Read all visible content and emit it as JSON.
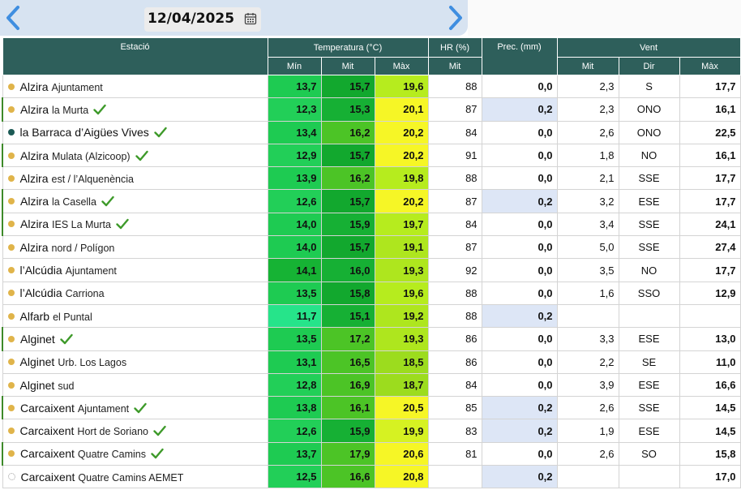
{
  "date": "12/04/2025",
  "icons": {
    "prev": "chevron-left-icon",
    "next": "chevron-right-icon",
    "calendar": "calendar-icon",
    "check": "checkmark-icon"
  },
  "colors": {
    "header": "#2e5f5b",
    "dot_default": "#e0b44a",
    "dot_dark": "#1c5a55",
    "check": "#3e9a2a",
    "prec_highlight": "#dde6f6"
  },
  "headers": {
    "station": "Estació",
    "temperature": "Temperatura (°C)",
    "humidity": "HR (%)",
    "precipitation": "Prec. (mm)",
    "wind": "Vent",
    "temp_min": "Mín",
    "temp_avg": "Mit",
    "temp_max": "Màx",
    "hr_avg": "Mit",
    "wind_avg": "Mit",
    "wind_dir": "Dir",
    "wind_max": "Màx"
  },
  "rows": [
    {
      "name": "Alzira",
      "sub": "Ajuntament",
      "check": false,
      "dot": "gold",
      "mark": false,
      "tmin": "13,7",
      "tavg": "15,7",
      "tmax": "19,6",
      "cmin": "#1ecb52",
      "cavg": "#12a82e",
      "cmax": "#b6ec1e",
      "hr": "88",
      "prec": "0,0",
      "pp": false,
      "wavg": "2,3",
      "wdir": "S",
      "wmax": "17,7"
    },
    {
      "name": "Alzira",
      "sub": "la Murta",
      "check": true,
      "dot": "gold",
      "mark": true,
      "tmin": "12,3",
      "tavg": "15,3",
      "tmax": "20,1",
      "cmin": "#22cf58",
      "cavg": "#16b034",
      "cmax": "#f6f626",
      "hr": "87",
      "prec": "0,2",
      "pp": true,
      "wavg": "2,3",
      "wdir": "ONO",
      "wmax": "16,1"
    },
    {
      "name": "la Barraca d’Aigües Vives",
      "sub": "",
      "check": true,
      "dot": "dark",
      "mark": false,
      "tmin": "13,4",
      "tavg": "16,2",
      "tmax": "20,2",
      "cmin": "#1ecb52",
      "cavg": "#4cc426",
      "cmax": "#f6f626",
      "hr": "84",
      "prec": "0,0",
      "pp": false,
      "wavg": "2,6",
      "wdir": "ONO",
      "wmax": "22,5"
    },
    {
      "name": "Alzira",
      "sub": "Mulata (Alzicoop)",
      "check": true,
      "dot": "gold",
      "mark": true,
      "tmin": "12,9",
      "tavg": "15,7",
      "tmax": "20,2",
      "cmin": "#22cf58",
      "cavg": "#12a82e",
      "cmax": "#f6f626",
      "hr": "91",
      "prec": "0,0",
      "pp": false,
      "wavg": "1,8",
      "wdir": "NO",
      "wmax": "16,1"
    },
    {
      "name": "Alzira",
      "sub": "est / l’Alquenència",
      "check": false,
      "dot": "gold",
      "mark": false,
      "tmin": "13,9",
      "tavg": "16,2",
      "tmax": "19,8",
      "cmin": "#1ecb52",
      "cavg": "#4cc426",
      "cmax": "#b6ec1e",
      "hr": "88",
      "prec": "0,0",
      "pp": false,
      "wavg": "2,1",
      "wdir": "SSE",
      "wmax": "17,7"
    },
    {
      "name": "Alzira",
      "sub": "la Casella",
      "check": true,
      "dot": "gold",
      "mark": true,
      "tmin": "12,6",
      "tavg": "15,7",
      "tmax": "20,2",
      "cmin": "#22cf58",
      "cavg": "#12a82e",
      "cmax": "#f6f626",
      "hr": "87",
      "prec": "0,2",
      "pp": true,
      "wavg": "3,2",
      "wdir": "ESE",
      "wmax": "17,7"
    },
    {
      "name": "Alzira",
      "sub": "IES La Murta",
      "check": true,
      "dot": "gold",
      "mark": true,
      "tmin": "14,0",
      "tavg": "15,9",
      "tmax": "19,7",
      "cmin": "#1ecb52",
      "cavg": "#16b034",
      "cmax": "#b6ec1e",
      "hr": "84",
      "prec": "0,0",
      "pp": false,
      "wavg": "3,4",
      "wdir": "SSE",
      "wmax": "24,1"
    },
    {
      "name": "Alzira",
      "sub": "nord / Polígon",
      "check": false,
      "dot": "gold",
      "mark": false,
      "tmin": "14,0",
      "tavg": "15,7",
      "tmax": "19,1",
      "cmin": "#1ecb52",
      "cavg": "#12a82e",
      "cmax": "#aee61e",
      "hr": "87",
      "prec": "0,0",
      "pp": false,
      "wavg": "5,0",
      "wdir": "SSE",
      "wmax": "27,4"
    },
    {
      "name": "l’Alcúdia",
      "sub": "Ajuntament",
      "check": false,
      "dot": "gold",
      "mark": false,
      "tmin": "14,1",
      "tavg": "16,0",
      "tmax": "19,3",
      "cmin": "#16b334",
      "cavg": "#16b034",
      "cmax": "#aee61e",
      "hr": "92",
      "prec": "0,0",
      "pp": false,
      "wavg": "3,5",
      "wdir": "NO",
      "wmax": "17,7"
    },
    {
      "name": "l’Alcúdia",
      "sub": "Carriona",
      "check": false,
      "dot": "gold",
      "mark": false,
      "tmin": "13,5",
      "tavg": "15,8",
      "tmax": "19,6",
      "cmin": "#1ecb52",
      "cavg": "#12a82e",
      "cmax": "#b6ec1e",
      "hr": "88",
      "prec": "0,0",
      "pp": false,
      "wavg": "1,6",
      "wdir": "SSO",
      "wmax": "12,9"
    },
    {
      "name": "Alfarb",
      "sub": "el Puntal",
      "check": false,
      "dot": "gold",
      "mark": false,
      "tmin": "11,7",
      "tavg": "15,1",
      "tmax": "19,2",
      "cmin": "#26e48a",
      "cavg": "#16b034",
      "cmax": "#aee61e",
      "hr": "88",
      "prec": "0,2",
      "pp": true,
      "wavg": "",
      "wdir": "",
      "wmax": ""
    },
    {
      "name": "Alginet",
      "sub": "",
      "check": true,
      "dot": "gold",
      "mark": true,
      "tmin": "13,5",
      "tavg": "17,2",
      "tmax": "19,3",
      "cmin": "#1ecb52",
      "cavg": "#4cc426",
      "cmax": "#aee61e",
      "hr": "86",
      "prec": "0,0",
      "pp": false,
      "wavg": "3,3",
      "wdir": "ESE",
      "wmax": "13,0"
    },
    {
      "name": "Alginet",
      "sub": "Urb. Los Lagos",
      "check": false,
      "dot": "gold",
      "mark": false,
      "tmin": "13,1",
      "tavg": "16,5",
      "tmax": "18,5",
      "cmin": "#1ecb52",
      "cavg": "#4cc426",
      "cmax": "#9cdc1e",
      "hr": "86",
      "prec": "0,0",
      "pp": false,
      "wavg": "2,2",
      "wdir": "SE",
      "wmax": "11,0"
    },
    {
      "name": "Alginet",
      "sub": "sud",
      "check": false,
      "dot": "gold",
      "mark": false,
      "tmin": "12,8",
      "tavg": "16,9",
      "tmax": "18,7",
      "cmin": "#22cf58",
      "cavg": "#4cc426",
      "cmax": "#9cdc1e",
      "hr": "84",
      "prec": "0,0",
      "pp": false,
      "wavg": "3,9",
      "wdir": "ESE",
      "wmax": "16,6"
    },
    {
      "name": "Carcaixent",
      "sub": "Ajuntament",
      "check": true,
      "dot": "gold",
      "mark": true,
      "tmin": "13,8",
      "tavg": "16,1",
      "tmax": "20,5",
      "cmin": "#1ecb52",
      "cavg": "#4cc426",
      "cmax": "#f6f626",
      "hr": "85",
      "prec": "0,2",
      "pp": true,
      "wavg": "2,6",
      "wdir": "SSE",
      "wmax": "14,5"
    },
    {
      "name": "Carcaixent",
      "sub": "Hort de Soriano",
      "check": true,
      "dot": "gold",
      "mark": false,
      "tmin": "12,6",
      "tavg": "15,9",
      "tmax": "19,9",
      "cmin": "#22cf58",
      "cavg": "#16b034",
      "cmax": "#d6f222",
      "hr": "83",
      "prec": "0,2",
      "pp": true,
      "wavg": "1,9",
      "wdir": "ESE",
      "wmax": "14,5"
    },
    {
      "name": "Carcaixent",
      "sub": "Quatre Camins",
      "check": true,
      "dot": "gold",
      "mark": true,
      "tmin": "13,7",
      "tavg": "17,9",
      "tmax": "20,6",
      "cmin": "#1ecb52",
      "cavg": "#4cc426",
      "cmax": "#f6f626",
      "hr": "81",
      "prec": "0,0",
      "pp": false,
      "wavg": "2,6",
      "wdir": "SO",
      "wmax": "15,8"
    },
    {
      "name": "Carcaixent",
      "sub": "Quatre Camins AEMET",
      "check": false,
      "dot": "empty",
      "mark": false,
      "tmin": "12,5",
      "tavg": "16,6",
      "tmax": "20,8",
      "cmin": "#22cf58",
      "cavg": "#4cc426",
      "cmax": "#f6f626",
      "hr": "",
      "prec": "0,2",
      "pp": true,
      "wavg": "",
      "wdir": "",
      "wmax": "17,0"
    }
  ]
}
